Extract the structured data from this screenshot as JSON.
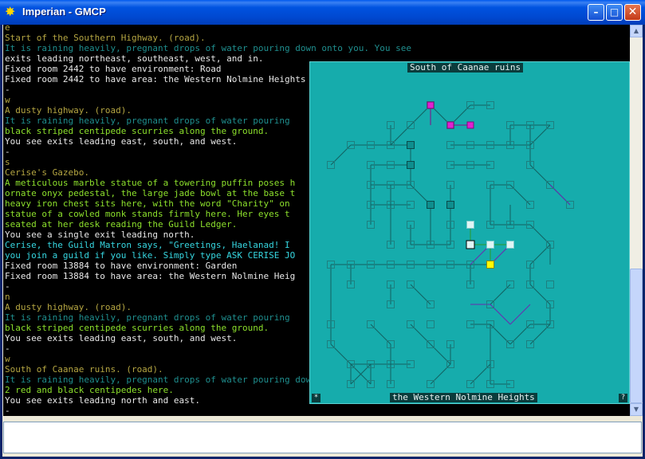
{
  "window": {
    "title": "Imperian - GMCP",
    "app_icon": "imperian-icon",
    "buttons": {
      "minimize": "–",
      "maximize": "□",
      "close": "✕"
    }
  },
  "console": {
    "lines": [
      {
        "text": "e",
        "color": "c-olive"
      },
      {
        "text": "Start of the Southern Highway. (road).",
        "color": "c-olive"
      },
      {
        "text": "It is raining heavily, pregnant drops of water pouring down onto you. You see",
        "color": "c-dim"
      },
      {
        "text": "exits leading northeast, southeast, west, and in.",
        "color": "c-white"
      },
      {
        "text": "Fixed room 2442 to have environment: Road",
        "color": "c-white"
      },
      {
        "text": "Fixed room 2442 to have area: the Western Nolmine Heights",
        "color": "c-white"
      },
      {
        "text": "-",
        "color": "c-white"
      },
      {
        "text": "w",
        "color": "c-olive"
      },
      {
        "text": "A dusty highway. (road).",
        "color": "c-olive"
      },
      {
        "text": "It is raining heavily, pregnant drops of water pouring",
        "color": "c-dim"
      },
      {
        "text": "black striped centipede scurries along the ground.",
        "color": "c-green"
      },
      {
        "text": "You see exits leading east, south, and west.",
        "color": "c-white"
      },
      {
        "text": "-",
        "color": "c-white"
      },
      {
        "text": "s",
        "color": "c-olive"
      },
      {
        "text": "Cerise's Gazebo.",
        "color": "c-olive"
      },
      {
        "text": "A meticulous marble statue of a towering puffin poses h",
        "color": "c-green"
      },
      {
        "text": "ornate onyx pedestal, the large jade bowl at the base t",
        "color": "c-green"
      },
      {
        "text": "heavy iron chest sits here, with the word \"Charity\" on",
        "color": "c-green"
      },
      {
        "text": "statue of a cowled monk stands firmly here. Her eyes t",
        "color": "c-green"
      },
      {
        "text": "seated at her desk reading the Guild Ledger.",
        "color": "c-green"
      },
      {
        "text": "You see a single exit leading north.",
        "color": "c-white"
      },
      {
        "text": "Cerise, the Guild Matron says, \"Greetings, Haelanad! I",
        "color": "c-cyan"
      },
      {
        "text": "you join a guild if you like. Simply type ASK CERISE JO",
        "color": "c-cyan"
      },
      {
        "text": "Fixed room 13884 to have environment: Garden",
        "color": "c-white"
      },
      {
        "text": "Fixed room 13884 to have area: the Western Nolmine Heig",
        "color": "c-white"
      },
      {
        "text": "-",
        "color": "c-white"
      },
      {
        "text": "n",
        "color": "c-olive"
      },
      {
        "text": "A dusty highway. (road).",
        "color": "c-olive"
      },
      {
        "text": "It is raining heavily, pregnant drops of water pouring",
        "color": "c-dim"
      },
      {
        "text": "black striped centipede scurries along the ground.",
        "color": "c-green"
      },
      {
        "text": "You see exits leading east, south, and west.",
        "color": "c-white"
      },
      {
        "text": "-",
        "color": "c-white"
      },
      {
        "text": "w",
        "color": "c-olive"
      },
      {
        "text": "South of Caanae ruins. (road).",
        "color": "c-olive"
      },
      {
        "text": "It is raining heavily, pregnant drops of water pouring down onto you. There are",
        "color": "c-dim"
      },
      {
        "text": "2 red and black centipedes here.",
        "color": "c-green"
      },
      {
        "text": "You see exits leading north and east.",
        "color": "c-white"
      },
      {
        "text": "-",
        "color": "c-white"
      }
    ]
  },
  "map": {
    "room_title": "South of Caanae ruins",
    "area_name": "the Western Nolmine Heights",
    "corner_left": "*",
    "corner_right": "?",
    "colors": {
      "background": "#16ACAC",
      "room_border": "#1E7F7F",
      "link": "#116060",
      "magenta": "#E020D0",
      "yellow": "#FFFF00",
      "white": "#E0F5F5",
      "current": "#000000"
    }
  },
  "scrollbar": {
    "up_icon": "▲",
    "down_icon": "▼"
  },
  "input": {
    "value": ""
  }
}
